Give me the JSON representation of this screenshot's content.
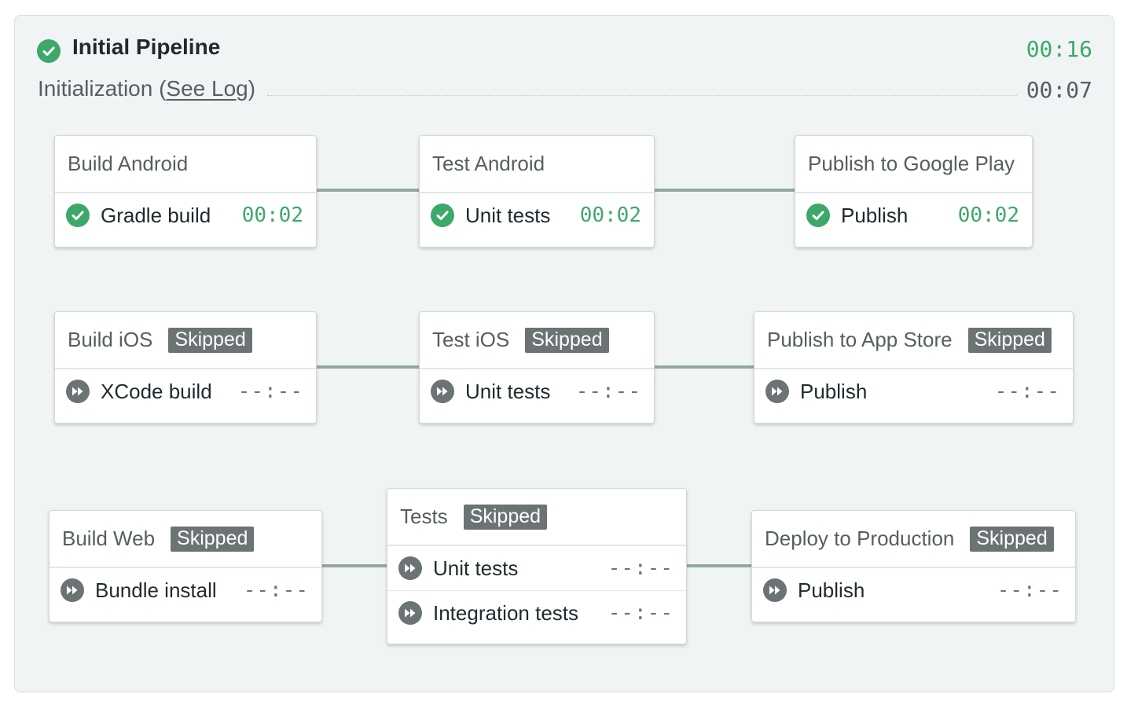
{
  "pipeline": {
    "title": "Initial Pipeline",
    "total_time": "00:16",
    "initialization_label": "Initialization",
    "see_log_open": "(",
    "see_log_link": "See Log",
    "see_log_close": ")",
    "initialization_time": "00:07",
    "status_icon": "check-circle-icon"
  },
  "colors": {
    "success": "#3da86a",
    "skipped": "#6b7375",
    "connector": "#94a8a3",
    "panel": "#f1f4f4"
  },
  "blocks": {
    "build_android": {
      "name": "Build Android",
      "jobs": [
        {
          "name": "Gradle build",
          "time": "00:02",
          "status": "passed"
        }
      ]
    },
    "test_android": {
      "name": "Test Android",
      "jobs": [
        {
          "name": "Unit tests",
          "time": "00:02",
          "status": "passed"
        }
      ]
    },
    "publish_google": {
      "name": "Publish to Google Play",
      "jobs": [
        {
          "name": "Publish",
          "time": "00:02",
          "status": "passed"
        }
      ]
    },
    "build_ios": {
      "name": "Build iOS",
      "badge": "Skipped",
      "jobs": [
        {
          "name": "XCode build",
          "time": "--:--",
          "status": "skipped"
        }
      ]
    },
    "test_ios": {
      "name": "Test iOS",
      "badge": "Skipped",
      "jobs": [
        {
          "name": "Unit tests",
          "time": "--:--",
          "status": "skipped"
        }
      ]
    },
    "publish_appstore": {
      "name": "Publish to App Store",
      "badge": "Skipped",
      "jobs": [
        {
          "name": "Publish",
          "time": "--:--",
          "status": "skipped"
        }
      ]
    },
    "build_web": {
      "name": "Build Web",
      "badge": "Skipped",
      "jobs": [
        {
          "name": "Bundle install",
          "time": "--:--",
          "status": "skipped"
        }
      ]
    },
    "tests": {
      "name": "Tests",
      "badge": "Skipped",
      "jobs": [
        {
          "name": "Unit tests",
          "time": "--:--",
          "status": "skipped"
        },
        {
          "name": "Integration tests",
          "time": "--:--",
          "status": "skipped"
        }
      ]
    },
    "deploy_production": {
      "name": "Deploy to Production",
      "badge": "Skipped",
      "jobs": [
        {
          "name": "Publish",
          "time": "--:--",
          "status": "skipped"
        }
      ]
    }
  }
}
